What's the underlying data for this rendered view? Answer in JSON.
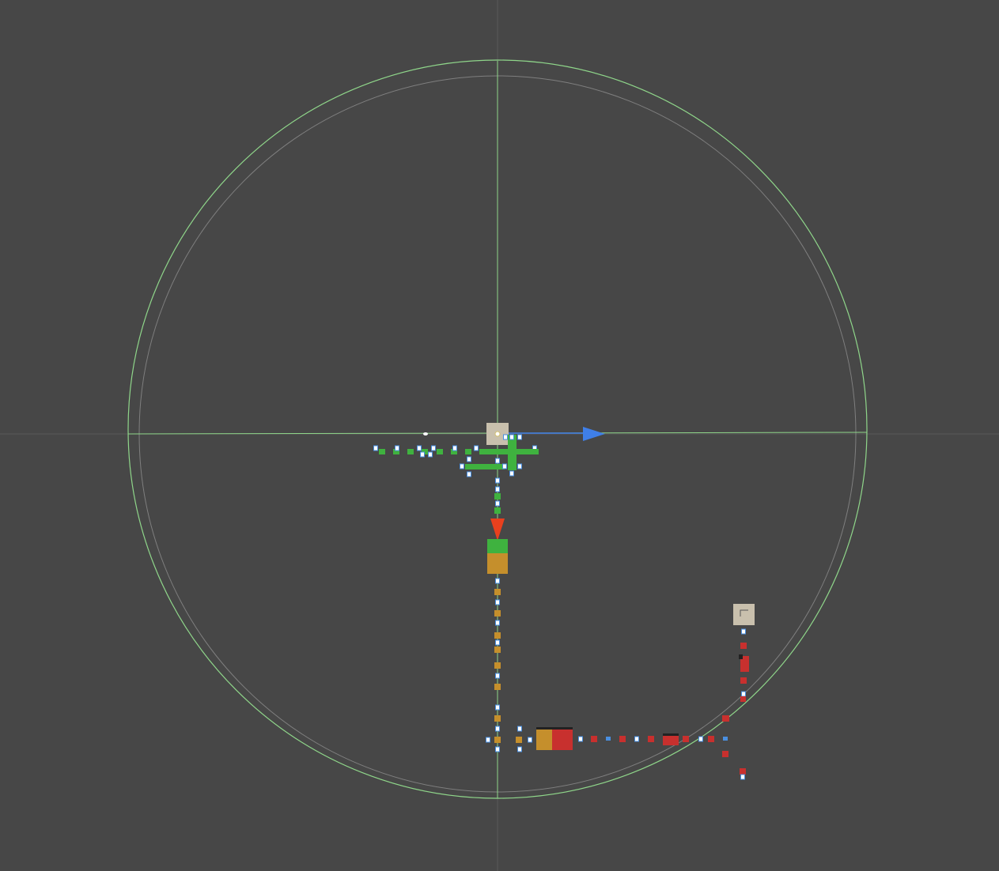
{
  "scene": {
    "background_color": "#474747",
    "gizmo_color": "#8fd68a",
    "inner_ring_color": "#8a8a8a",
    "handle_color": "#3a7bd5",
    "arrow_colors": {
      "x_axis": "#3f7fe8",
      "z_axis": "#e8401e"
    },
    "block_colors": {
      "green": "#3fb23f",
      "orange": "#c58f2c",
      "red": "#c8302e",
      "beige": "#c9c0ad",
      "handle_fill": "#ffffff",
      "handle_stroke": "#4a8fe0"
    },
    "icons": [
      "move-x-arrow-icon",
      "move-z-arrow-icon",
      "pivot-handle-icon",
      "light-gizmo-icon",
      "rotation-circle-icon"
    ]
  }
}
